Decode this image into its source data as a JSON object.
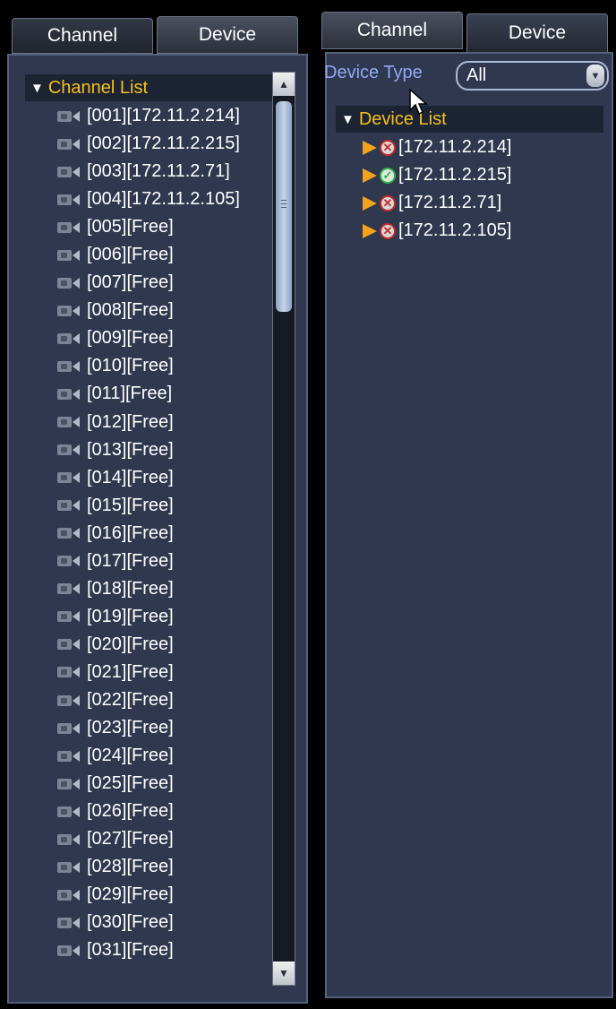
{
  "left_panel": {
    "tabs": [
      {
        "label": "Channel"
      },
      {
        "label": "Device"
      }
    ],
    "channel_list_title": "Channel List",
    "channels": [
      {
        "label": "[001][172.11.2.214]"
      },
      {
        "label": "[002][172.11.2.215]"
      },
      {
        "label": "[003][172.11.2.71]"
      },
      {
        "label": "[004][172.11.2.105]"
      },
      {
        "label": "[005][Free]"
      },
      {
        "label": "[006][Free]"
      },
      {
        "label": "[007][Free]"
      },
      {
        "label": "[008][Free]"
      },
      {
        "label": "[009][Free]"
      },
      {
        "label": "[010][Free]"
      },
      {
        "label": "[011][Free]"
      },
      {
        "label": "[012][Free]"
      },
      {
        "label": "[013][Free]"
      },
      {
        "label": "[014][Free]"
      },
      {
        "label": "[015][Free]"
      },
      {
        "label": "[016][Free]"
      },
      {
        "label": "[017][Free]"
      },
      {
        "label": "[018][Free]"
      },
      {
        "label": "[019][Free]"
      },
      {
        "label": "[020][Free]"
      },
      {
        "label": "[021][Free]"
      },
      {
        "label": "[022][Free]"
      },
      {
        "label": "[023][Free]"
      },
      {
        "label": "[024][Free]"
      },
      {
        "label": "[025][Free]"
      },
      {
        "label": "[026][Free]"
      },
      {
        "label": "[027][Free]"
      },
      {
        "label": "[028][Free]"
      },
      {
        "label": "[029][Free]"
      },
      {
        "label": "[030][Free]"
      },
      {
        "label": "[031][Free]"
      }
    ]
  },
  "right_panel": {
    "tabs": [
      {
        "label": "Channel"
      },
      {
        "label": "Device"
      }
    ],
    "device_type_label": "Device Type",
    "device_type_value": "All",
    "device_list_title": "Device List",
    "devices": [
      {
        "label": "[172.11.2.214]",
        "status": "offline"
      },
      {
        "label": "[172.11.2.215]",
        "status": "online"
      },
      {
        "label": "[172.11.2.71]",
        "status": "offline"
      },
      {
        "label": "[172.11.2.105]",
        "status": "offline"
      }
    ]
  },
  "colors": {
    "panel_bg": "#2f384f",
    "tree_header_text": "#f4c21e",
    "device_type_label": "#8ea9f5",
    "expand_arrow": "#f3a21b",
    "offline": "#c42a2a",
    "online": "#2fb34a"
  },
  "icons": {
    "channel_item": "camera-icon",
    "tree_header": "triangle-down-icon",
    "device_expand": "chevron-right-icon",
    "device_status_offline": "offline-x-icon",
    "device_status_online": "online-check-icon"
  }
}
